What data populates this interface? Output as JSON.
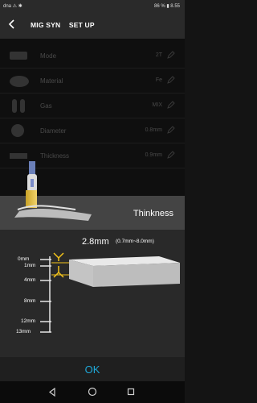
{
  "status_bar": {
    "left": "dna ⚠ ✱",
    "right": "86 % ▮ 8.55"
  },
  "app_bar": {
    "back_icon": "chevron-left-icon",
    "title_1": "MIG SYN",
    "title_2": "SET UP"
  },
  "rows": [
    {
      "label": "Mode",
      "value": "2T",
      "icon": "torch-icon"
    },
    {
      "label": "Material",
      "value": "Fe",
      "icon": "material-icon"
    },
    {
      "label": "Gas",
      "value": "MIX",
      "icon": "gas-cylinder-icon"
    },
    {
      "label": "Diameter",
      "value": "0.8mm",
      "icon": "wire-spool-icon"
    },
    {
      "label": "Thickness",
      "value": "0.9mm",
      "icon": "plate-icon"
    }
  ],
  "dialog": {
    "title": "Thinkness",
    "value": "2.8mm",
    "range": "(0.7mm~8.0mm)",
    "scale_labels": [
      "0mm",
      "1mm",
      "4mm",
      "8mm",
      "12mm",
      "13mm"
    ]
  },
  "ok_label": "OK",
  "nav": [
    "back-triangle-icon",
    "home-circle-icon",
    "recent-square-icon"
  ],
  "colors": {
    "accent": "#1ea6d6",
    "background": "#141414",
    "dialog": "#292929"
  }
}
